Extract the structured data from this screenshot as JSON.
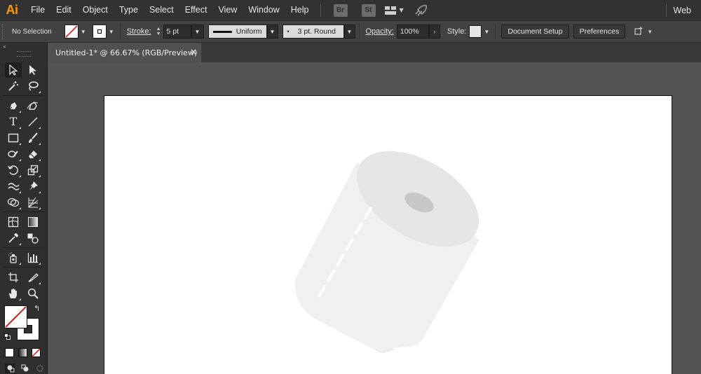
{
  "app": {
    "logo": "Ai",
    "workspace": "Web"
  },
  "menu": [
    "File",
    "Edit",
    "Object",
    "Type",
    "Select",
    "Effect",
    "View",
    "Window",
    "Help"
  ],
  "bridge_badges": [
    "Br",
    "St"
  ],
  "control": {
    "selection": "No Selection",
    "stroke_label": "Stroke:",
    "stroke_weight": "5 pt",
    "profile": "Uniform",
    "brush": "3 pt. Round",
    "opacity_label": "Opacity:",
    "opacity": "100%",
    "style_label": "Style:",
    "doc_setup": "Document Setup",
    "preferences": "Preferences"
  },
  "document": {
    "tab_title": "Untitled-1* @ 66.67% (RGB/Preview)",
    "close": "×"
  },
  "colors": {
    "accent_logo": "#ff9a00",
    "roll_light": "#f0f0f0",
    "roll_top": "#e6e6e6",
    "roll_hole": "#c8c8c8"
  },
  "tools": [
    [
      "selection-tool",
      "direct-selection-tool"
    ],
    [
      "magic-wand-tool",
      "lasso-tool"
    ],
    [
      "pen-tool",
      "curvature-tool"
    ],
    [
      "type-tool",
      "line-segment-tool"
    ],
    [
      "rectangle-tool",
      "paintbrush-tool"
    ],
    [
      "shaper-tool",
      "eraser-tool"
    ],
    [
      "rotate-tool",
      "scale-tool"
    ],
    [
      "warp-tool",
      "puppet-warp-tool"
    ],
    [
      "shape-builder-tool",
      "perspective-grid-tool"
    ],
    [
      "mesh-tool",
      "gradient-tool"
    ],
    [
      "eyedropper-tool",
      "blend-tool"
    ],
    [
      "symbol-sprayer-tool",
      "column-graph-tool"
    ],
    [
      "artboard-tool",
      "slice-tool"
    ],
    [
      "hand-tool",
      "zoom-tool"
    ]
  ]
}
